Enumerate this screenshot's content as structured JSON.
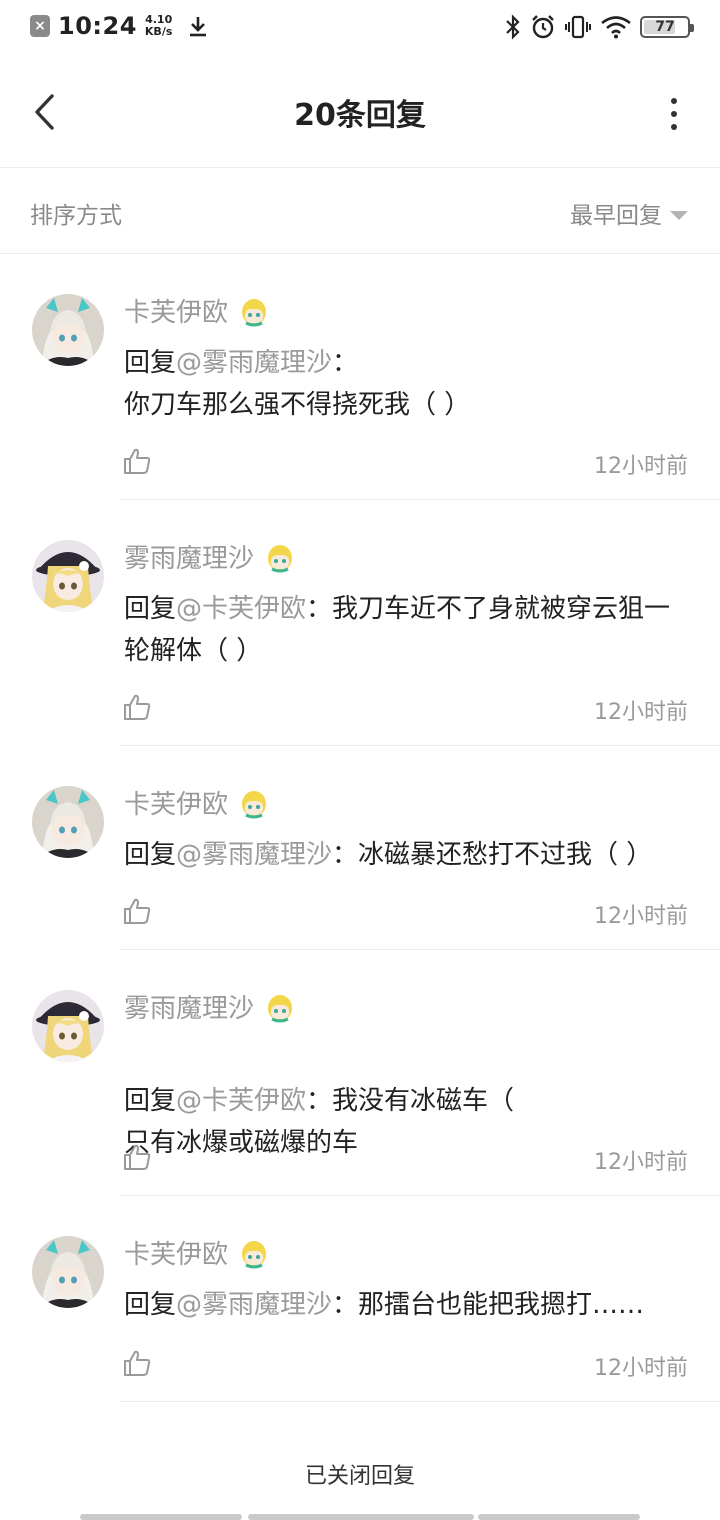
{
  "status_bar": {
    "time": "10:24",
    "net_speed_value": "4.10",
    "net_speed_unit": "KB/s",
    "battery": "77",
    "battery_level_pct": 77
  },
  "header": {
    "title": "20条回复"
  },
  "sort": {
    "label": "排序方式",
    "selected": "最早回复"
  },
  "comments": [
    {
      "user": "卡芙伊欧",
      "reply_prefix": "回复",
      "mention": "@雾雨魔理沙",
      "sep": "：",
      "text": "你刀车那么强不得挠死我（ ）",
      "time": "12小时前",
      "avatar": "kafu"
    },
    {
      "user": "雾雨魔理沙",
      "reply_prefix": "回复",
      "mention": "@卡芙伊欧",
      "sep": "：",
      "text": "我刀车近不了身就被穿云狙一轮解体（ ）",
      "time": "12小时前",
      "avatar": "marisa"
    },
    {
      "user": "卡芙伊欧",
      "reply_prefix": "回复",
      "mention": "@雾雨魔理沙",
      "sep": "：",
      "text": "冰磁暴还愁打不过我（ ）",
      "time": "12小时前",
      "avatar": "kafu"
    },
    {
      "user": "雾雨魔理沙",
      "reply_prefix": "回复",
      "mention": "@卡芙伊欧",
      "sep": "：",
      "text": "我没有冰磁车（\n只有冰爆或磁爆的车",
      "time": "12小时前",
      "avatar": "marisa"
    },
    {
      "user": "卡芙伊欧",
      "reply_prefix": "回复",
      "mention": "@雾雨魔理沙",
      "sep": "：",
      "text": "那擂台也能把我摁打……",
      "time": "12小时前",
      "avatar": "kafu"
    }
  ],
  "footer": {
    "closed_text": "已关闭回复"
  },
  "colors": {
    "muted": "#9a9a9a",
    "text": "#222222",
    "divider": "#ececec"
  }
}
